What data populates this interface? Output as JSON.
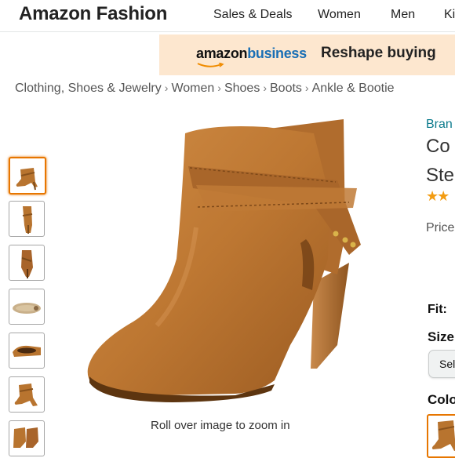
{
  "header": {
    "brand": "Amazon Fashion",
    "nav": [
      "Sales & Deals",
      "Women",
      "Men",
      "Ki"
    ]
  },
  "banner": {
    "logo_amazon": "amazon",
    "logo_business": "business",
    "tagline": "Reshape buying",
    "colors": {
      "bg": "#fde7cf",
      "business": "#1a6fb5"
    }
  },
  "breadcrumb": [
    "Clothing, Shoes & Jewelry",
    "Women",
    "Shoes",
    "Boots",
    "Ankle & Bootie"
  ],
  "gallery": {
    "thumbnail_count": 7,
    "active_index": 0,
    "zoom_hint": "Roll over image to zoom in"
  },
  "product": {
    "brand_link": "Bran",
    "title_line1": "Co",
    "title_line2": "Ste",
    "rating_stars": "★★",
    "price_label": "Price",
    "fit_label": "Fit:",
    "size_label": "Size",
    "size_select": "Sel",
    "color_label": "Colo"
  },
  "icons": [
    "chevron-right-icon",
    "star-icon",
    "boot-image"
  ],
  "colors": {
    "accent": "#e77600",
    "link": "#0a7a8c",
    "star": "#f39c12",
    "boot": "#b8742f"
  }
}
